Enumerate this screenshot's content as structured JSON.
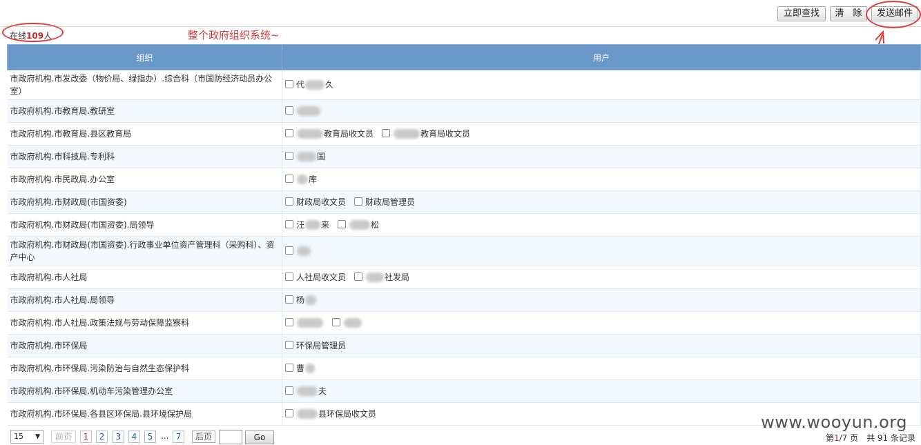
{
  "toolbar": {
    "search_label": "立即查找",
    "clear_label": "清　除",
    "send_mail_label": "发送邮件"
  },
  "online": {
    "prefix": "在线",
    "count": "109",
    "suffix": "人"
  },
  "annotation": {
    "text": "整个政府组织系统~",
    "color": "#d33b3b"
  },
  "table": {
    "headers": [
      "组织",
      "用户"
    ],
    "rows": [
      {
        "org": "市政府机构.市发改委（物价局、绿指办）.综合科（市国防经济动员办公室）",
        "users": [
          {
            "pre": "代",
            "blur": 28,
            "post": "久"
          }
        ]
      },
      {
        "org": "市政府机构.市教育局.教研室",
        "users": [
          {
            "pre": "",
            "blur": 34,
            "post": ""
          }
        ]
      },
      {
        "org": "市政府机构.市教育局.县区教育局",
        "users": [
          {
            "pre": "",
            "blur": 38,
            "post": "教育局收文员"
          },
          {
            "pre": "",
            "blur": 38,
            "post": "教育局收文员"
          }
        ]
      },
      {
        "org": "市政府机构.市科技局.专利科",
        "users": [
          {
            "pre": "",
            "blur": 28,
            "post": "国"
          }
        ]
      },
      {
        "org": "市政府机构.市民政局.办公室",
        "users": [
          {
            "pre": "",
            "blur": 16,
            "post": "库"
          }
        ]
      },
      {
        "org": "市政府机构.市财政局(市国资委)",
        "users": [
          {
            "pre": "财政局收文员",
            "blur": 0,
            "post": ""
          },
          {
            "pre": "财政局管理员",
            "blur": 0,
            "post": ""
          }
        ]
      },
      {
        "org": "市政府机构.市财政局(市国资委).局领导",
        "users": [
          {
            "pre": "汪",
            "blur": 22,
            "post": "来"
          },
          {
            "pre": "",
            "blur": 30,
            "post": "松"
          }
        ]
      },
      {
        "org": "市政府机构.市财政局(市国资委).行政事业单位资产管理科（采购科）、资产中心",
        "users": [
          {
            "pre": "",
            "blur": 20,
            "post": ""
          }
        ]
      },
      {
        "org": "市政府机构.市人社局",
        "users": [
          {
            "pre": "人社局收文员",
            "blur": 0,
            "post": ""
          },
          {
            "pre": "",
            "blur": 26,
            "post": "社发局"
          }
        ]
      },
      {
        "org": "市政府机构.市人社局.局领导",
        "users": [
          {
            "pre": "杨",
            "blur": 16,
            "post": ""
          }
        ]
      },
      {
        "org": "市政府机构.市人社局.政策法规与劳动保障监察科",
        "users": [
          {
            "pre": "",
            "blur": 38,
            "post": ""
          },
          {
            "pre": "",
            "blur": 26,
            "post": ""
          }
        ]
      },
      {
        "org": "市政府机构.市环保局",
        "users": [
          {
            "pre": "环保局管理员",
            "blur": 0,
            "post": ""
          }
        ]
      },
      {
        "org": "市政府机构.市环保局.污染防治与自然生态保护科",
        "users": [
          {
            "pre": "曹",
            "blur": 14,
            "post": ""
          }
        ]
      },
      {
        "org": "市政府机构.市环保局.机动车污染管理办公室",
        "users": [
          {
            "pre": "",
            "blur": 30,
            "post": "夫"
          }
        ]
      },
      {
        "org": "市政府机构.市环保局.各县区环保局.县环境保护局",
        "users": [
          {
            "pre": "",
            "blur": 30,
            "post": "县环保局收文员"
          }
        ]
      }
    ]
  },
  "pager": {
    "page_size": "15",
    "prev_label": "前页",
    "pages": [
      "1",
      "2",
      "3",
      "4",
      "5"
    ],
    "ellipsis": "...",
    "last_page": "7",
    "next_label": "后页",
    "go_label": "Go",
    "info": {
      "prefix": "第",
      "current": "1",
      "rest": "/7 页　共 91 条记录"
    }
  },
  "watermark": "www.wooyun.org"
}
